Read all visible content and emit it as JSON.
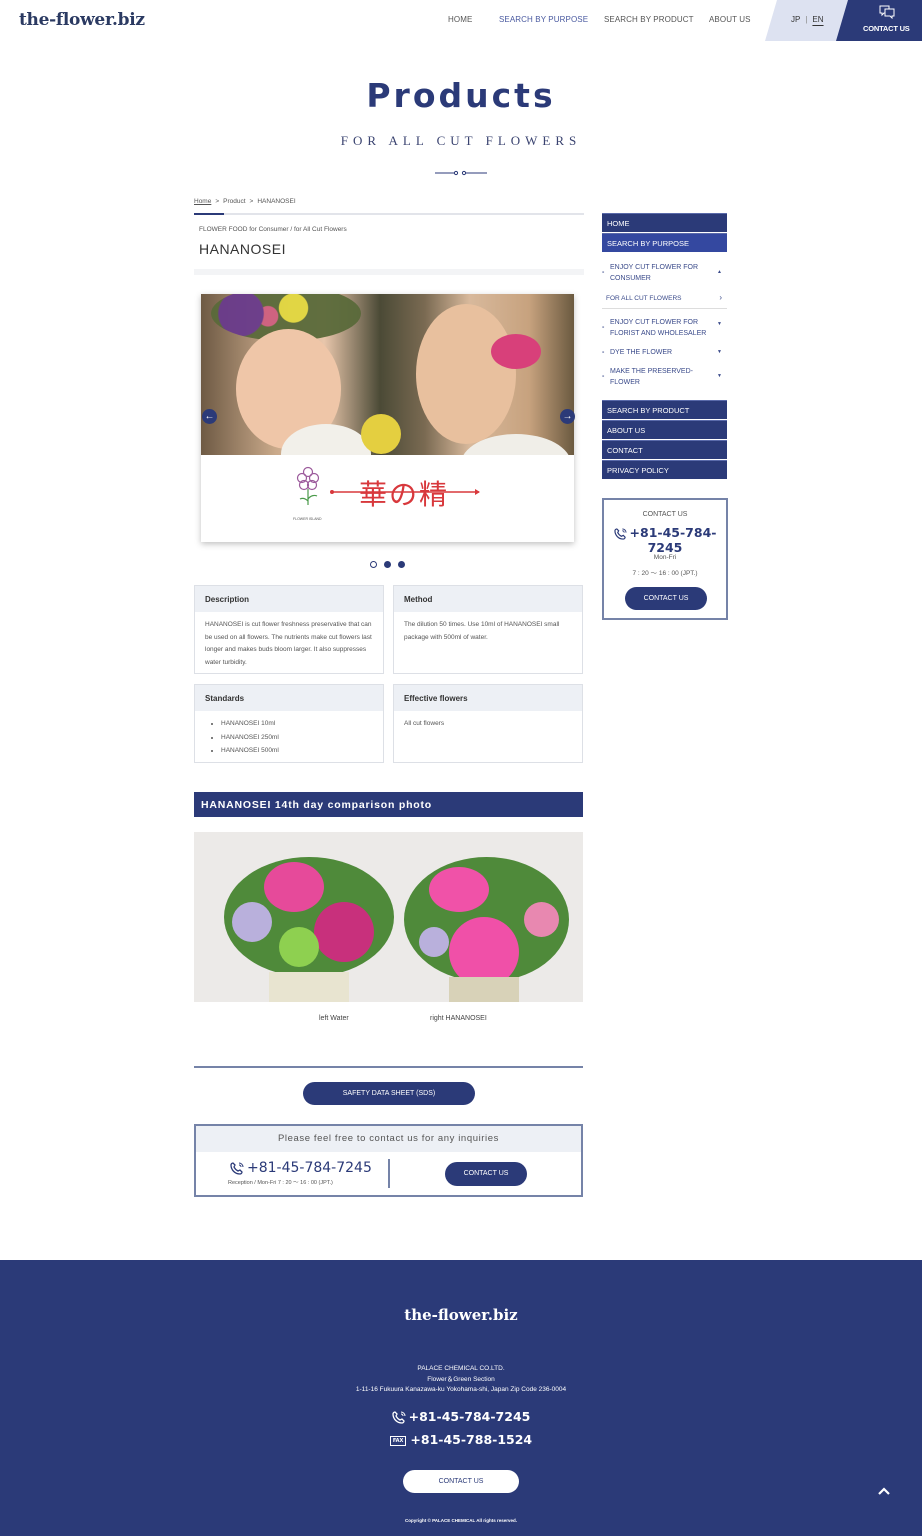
{
  "header": {
    "logo": "the-flower.biz",
    "nav": [
      "HOME",
      "SEARCH BY PURPOSE",
      "SEARCH BY PRODUCT",
      "ABOUT US"
    ],
    "lang_jp": "JP",
    "lang_sep": "|",
    "lang_en": "EN",
    "contact": "CONTACT US"
  },
  "hero": {
    "title": "Products",
    "subtitle": "FOR ALL CUT FLOWERS"
  },
  "breadcrumb": [
    "Home",
    "Product",
    "HANANOSEI"
  ],
  "breadcrumb_sep": ">",
  "product": {
    "category": "FLOWER FOOD for Consumer / for All Cut Flowers",
    "name": "HANANOSEI",
    "logo_text": "華の精",
    "logo_caption": "FLOWER ISLAND",
    "carousel": {
      "slides": 3,
      "current": 1,
      "prev": "←",
      "next": "→"
    },
    "description": {
      "title": "Description",
      "body": "HANANOSEI is cut flower freshness preservative that can be used on all flowers. The nutrients make cut flowers last longer and makes buds bloom larger. It also suppresses water turbidity."
    },
    "method": {
      "title": "Method",
      "body": "The dilution 50 times. Use 10ml of HANANOSEI small package with 500ml of water."
    },
    "standards": {
      "title": "Standards",
      "items": [
        "HANANOSEI 10ml",
        "HANANOSEI 250ml",
        "HANANOSEI 500ml"
      ]
    },
    "effective": {
      "title": "Effective flowers",
      "body": "All cut flowers"
    }
  },
  "comparison": {
    "title": "HANANOSEI 14th day comparison photo",
    "left_caption": "left Water",
    "right_caption": "right HANANOSEI"
  },
  "sds_button": "SAFETY DATA SHEET (SDS)",
  "inquiry": {
    "title": "Please feel free to contact us for any inquiries",
    "phone": "+81-45-784-7245",
    "reception": "Reception / Mon-Fri 7 : 20 ～ 16 : 00 (JPT.)",
    "button": "CONTACT US"
  },
  "sidebar": {
    "items_top": [
      "HOME",
      "SEARCH BY PURPOSE"
    ],
    "sub_items": [
      {
        "label": "ENJOY CUT FLOWER FOR CONSUMER",
        "caret": "▲"
      },
      {
        "label": "FOR ALL CUT FLOWERS",
        "caret": "›"
      },
      {
        "label": "ENJOY CUT FLOWER FOR FLORIST AND WHOLESALER",
        "caret": "▼"
      },
      {
        "label": "DYE THE FLOWER",
        "caret": "▼"
      },
      {
        "label": "MAKE THE PRESERVED-FLOWER",
        "caret": "▼"
      }
    ],
    "items_bottom": [
      "SEARCH BY PRODUCT",
      "ABOUT US",
      "CONTACT",
      "PRIVACY POLICY"
    ],
    "contact": {
      "title": "CONTACT US",
      "phone": "+81-45-784-7245",
      "days": "Mon-Fri",
      "hours": "7 : 20 ～ 16 : 00 (JPT.)",
      "button": "CONTACT US"
    }
  },
  "footer": {
    "logo": "the-flower.biz",
    "company": "PALACE CHEMICAL CO.LTD.",
    "section": "Flower＆Green Section",
    "address": "1-11-16 Fukuura Kanazawa-ku Yokohama-shi, Japan Zip Code 236-0004",
    "phone": "+81-45-784-7245",
    "fax_label": "FAX",
    "fax": "+81-45-788-1524",
    "button": "CONTACT US",
    "copyright": "Copyright © PALACE CHEMICAL All rights reserved.",
    "to_top": "^"
  },
  "colors": {
    "brand": "#2b3a78",
    "accent_red": "#d8383c",
    "light_bg": "#edf0f5"
  }
}
